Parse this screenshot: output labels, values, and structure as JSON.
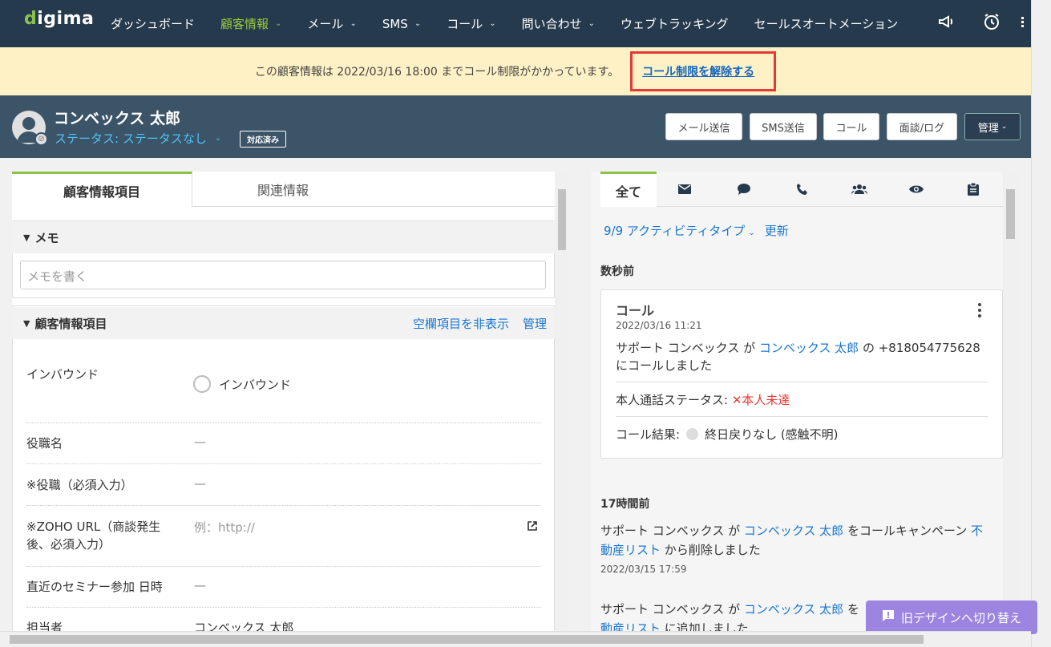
{
  "nav": {
    "logo": "digima",
    "items": [
      {
        "label": "ダッシュボード",
        "active": false,
        "dropdown": false
      },
      {
        "label": "顧客情報",
        "active": true,
        "dropdown": true
      },
      {
        "label": "メール",
        "active": false,
        "dropdown": true
      },
      {
        "label": "SMS",
        "active": false,
        "dropdown": true
      },
      {
        "label": "コール",
        "active": false,
        "dropdown": true
      },
      {
        "label": "問い合わせ",
        "active": false,
        "dropdown": true
      },
      {
        "label": "ウェブトラッキング",
        "active": false,
        "dropdown": false
      },
      {
        "label": "セールスオートメーション",
        "active": false,
        "dropdown": false
      }
    ],
    "icons": [
      "megaphone-icon",
      "alarm-clock-icon",
      "app-grid-icon"
    ],
    "accent": "#9ccc3a",
    "bg": "#263a4d"
  },
  "banner": {
    "text": "この顧客情報は 2022/03/16 18:00 までコール制限がかかっています。",
    "link": "コール制限を解除する",
    "highlight_color": "#e53935"
  },
  "customer": {
    "name": "コンベックス 太郎",
    "status": "ステータス: ステータスなし",
    "badge": "対応済み",
    "buttons": {
      "mail": "メール送信",
      "sms": "SMS送信",
      "call": "コール",
      "meeting": "面談/ログ",
      "manage": "管理"
    }
  },
  "left": {
    "tabs": [
      "顧客情報項目",
      "関連情報"
    ],
    "memo": {
      "title": "メモ",
      "placeholder": "メモを書く"
    },
    "info": {
      "title": "顧客情報項目",
      "hide_empty": "空欄項目を非表示",
      "manage": "管理",
      "fields": [
        {
          "label": "インバウンド",
          "value": "インバウンド"
        },
        {
          "label": "役職名",
          "value": "—"
        },
        {
          "label": "※役職（必須入力）",
          "value": "—"
        },
        {
          "label": "※ZOHO URL（商談発生",
          "label2": "後、必須入力）",
          "value": "例：http://"
        },
        {
          "label": "直近のセミナー参加 日時",
          "value": "—"
        },
        {
          "label": "担当者",
          "value": "コンベックス 太郎"
        }
      ]
    }
  },
  "right": {
    "tabs": [
      "全て",
      "mail-icon",
      "chat-icon",
      "phone-icon",
      "group-icon",
      "eye-icon",
      "clipboard-icon"
    ],
    "filter": "9/9 アクティビティタイプ",
    "refresh": "更新",
    "group1": "数秒前",
    "card": {
      "title": "コール",
      "time": "2022/03/16 11:21",
      "line_pre": "サポート コンベックス が ",
      "line_link": "コンベックス 太郎",
      "line_post": " の +818054775628",
      "line2": "にコールしました",
      "status_label": "本人通話ステータス:",
      "status_value": "本人未達",
      "result_label": "コール結果:",
      "result_value": "終日戻りなし (感触不明)"
    },
    "group2": "17時間前",
    "entry1": {
      "pre": "サポート コンベックス が ",
      "link": "コンベックス 太郎",
      "mid": " をコールキャンペーン ",
      "link2a": "不",
      "link2b": "動産リスト",
      "post": " から削除しました",
      "time": "2022/03/15 17:59"
    },
    "entry2": {
      "pre": "サポート コンベックス が ",
      "link": "コンベックス 太郎",
      "mid": " を",
      "link2b": "動産リスト",
      "post": " に追加しました"
    }
  },
  "float_button": "旧デザインへ切り替え"
}
